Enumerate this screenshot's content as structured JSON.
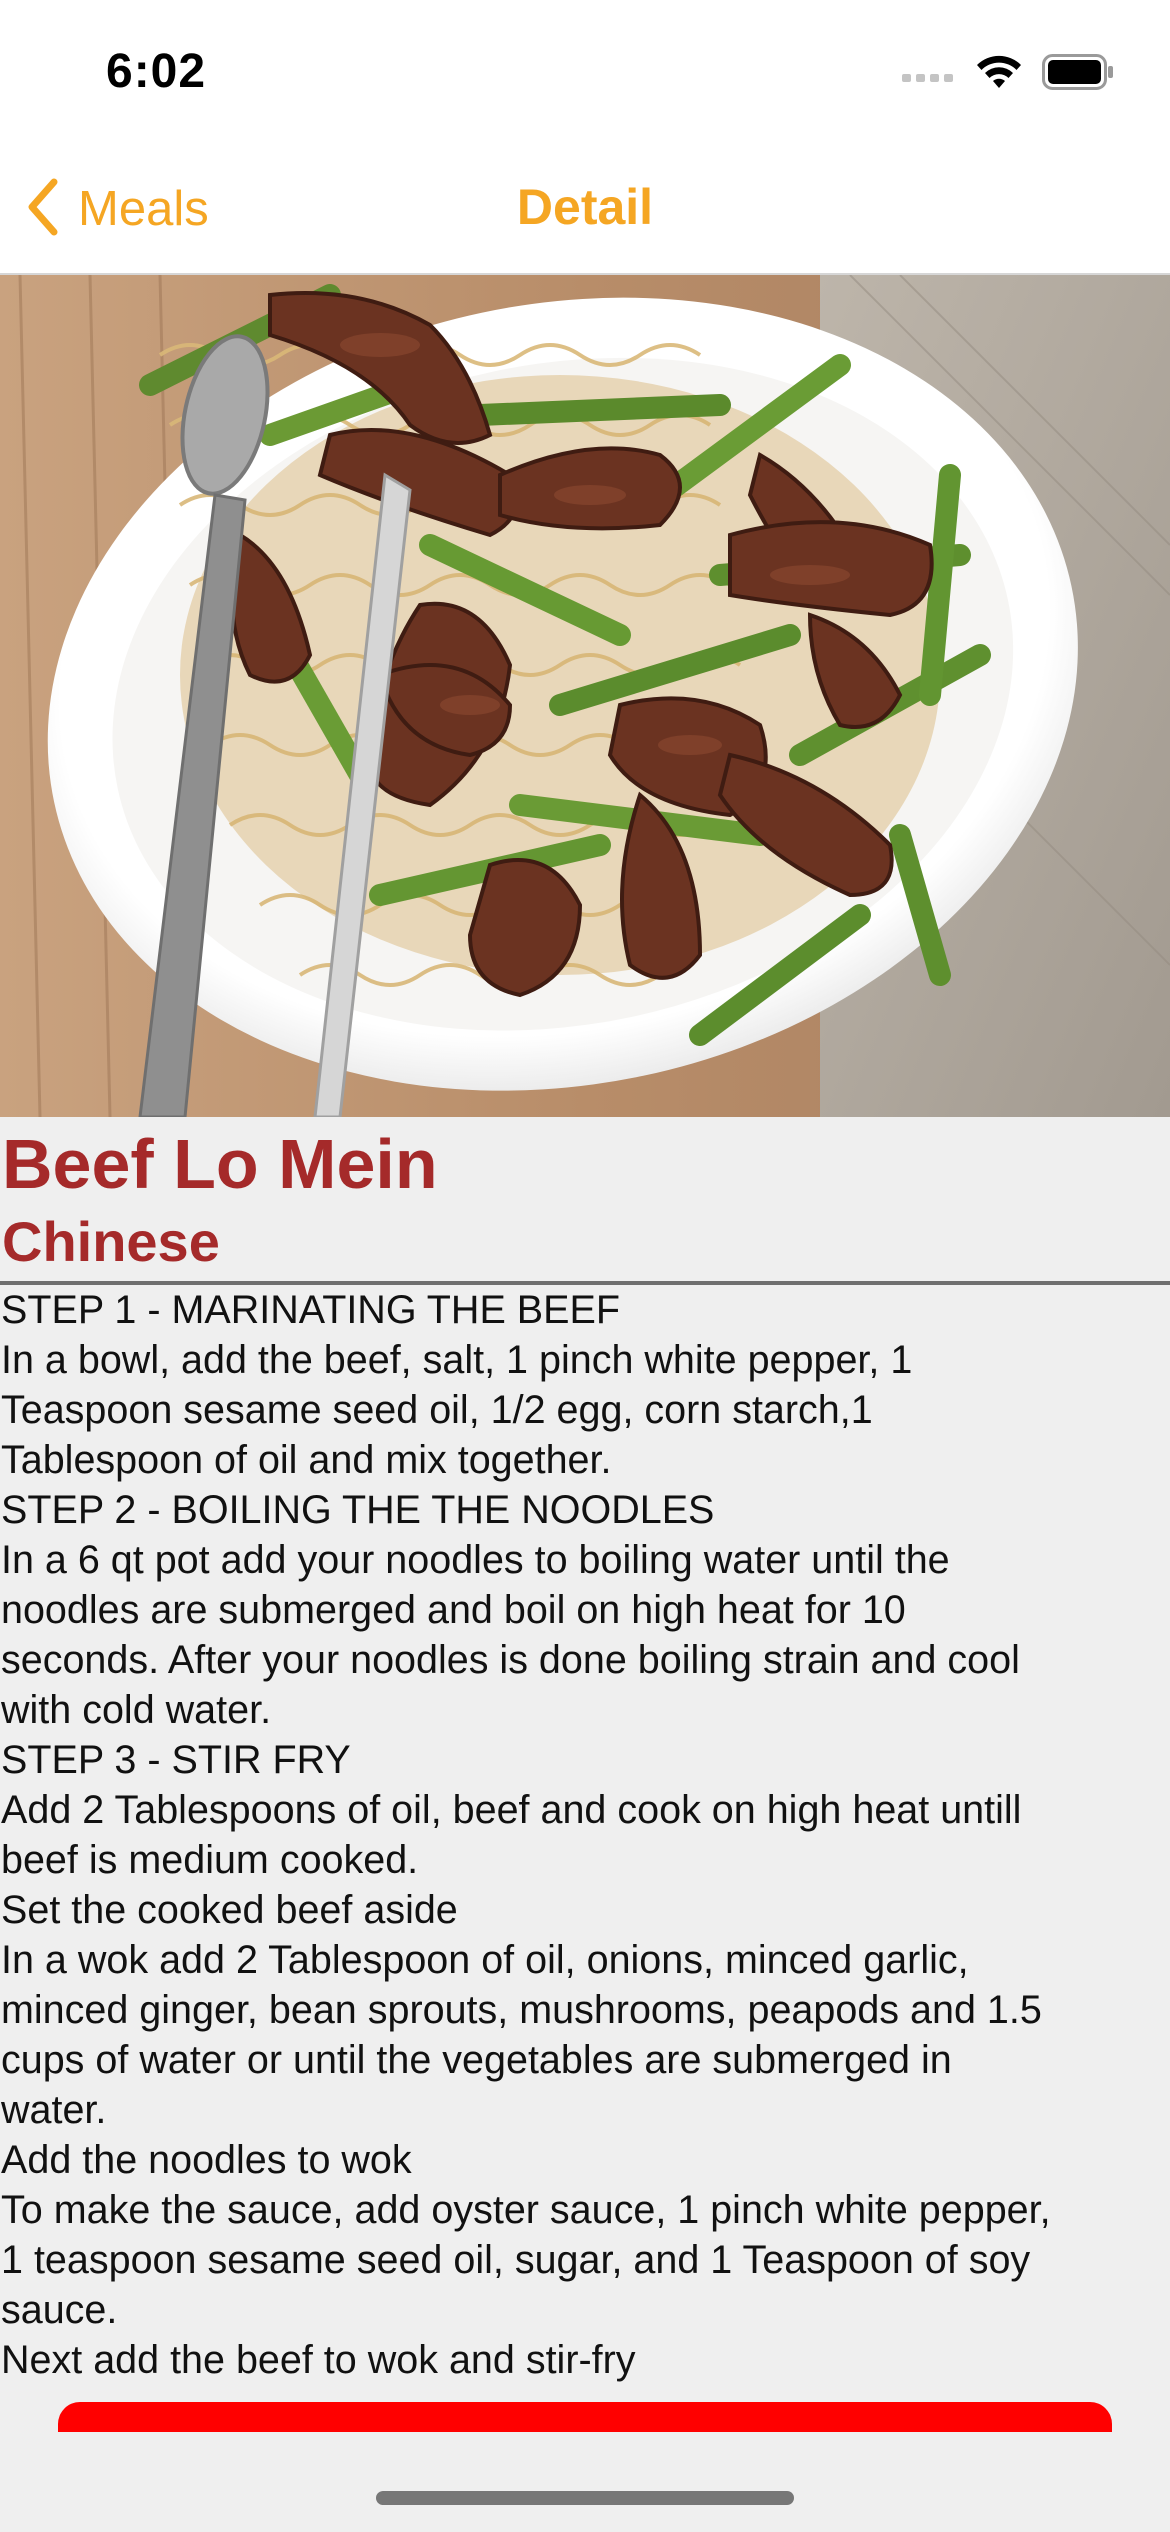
{
  "status_bar": {
    "time": "6:02",
    "icons": [
      "cellular-signal-icon",
      "wifi-icon",
      "battery-icon"
    ]
  },
  "nav": {
    "back_label": "Meals",
    "title": "Detail",
    "accent_color": "#f5a623"
  },
  "meal": {
    "image_alt": "Beef Lo Mein",
    "name": "Beef Lo Mein",
    "area": "Chinese",
    "title_color": "#a52a2a"
  },
  "instructions": [
    "STEP 1 - MARINATING THE BEEF",
    "In a bowl, add the beef, salt, 1 pinch white pepper, 1",
    "Teaspoon sesame seed oil, 1/2 egg, corn starch,1",
    "Tablespoon of oil and mix together.",
    "STEP 2 - BOILING THE THE NOODLES",
    "In a 6 qt pot add your noodles to boiling water until the",
    "noodles are submerged and boil on high heat for 10",
    "seconds. After your noodles is done boiling strain and cool",
    "with cold water.",
    "STEP 3 - STIR FRY",
    "Add 2 Tablespoons of oil, beef and cook on high heat untill",
    "beef is medium cooked.",
    "Set the cooked beef aside",
    "In a wok add 2 Tablespoon of oil, onions, minced garlic,",
    "minced ginger, bean sprouts, mushrooms, peapods and 1.5",
    "cups of water or until the vegetables are submerged in",
    "water.",
    "Add the noodles to wok",
    "To make the sauce, add oyster sauce, 1 pinch white pepper,",
    "1 teaspoon sesame seed oil, sugar, and 1 Teaspoon of soy",
    "sauce.",
    "Next add the beef to wok and stir-fry"
  ],
  "bottom_button": {
    "color": "#ff0000"
  }
}
